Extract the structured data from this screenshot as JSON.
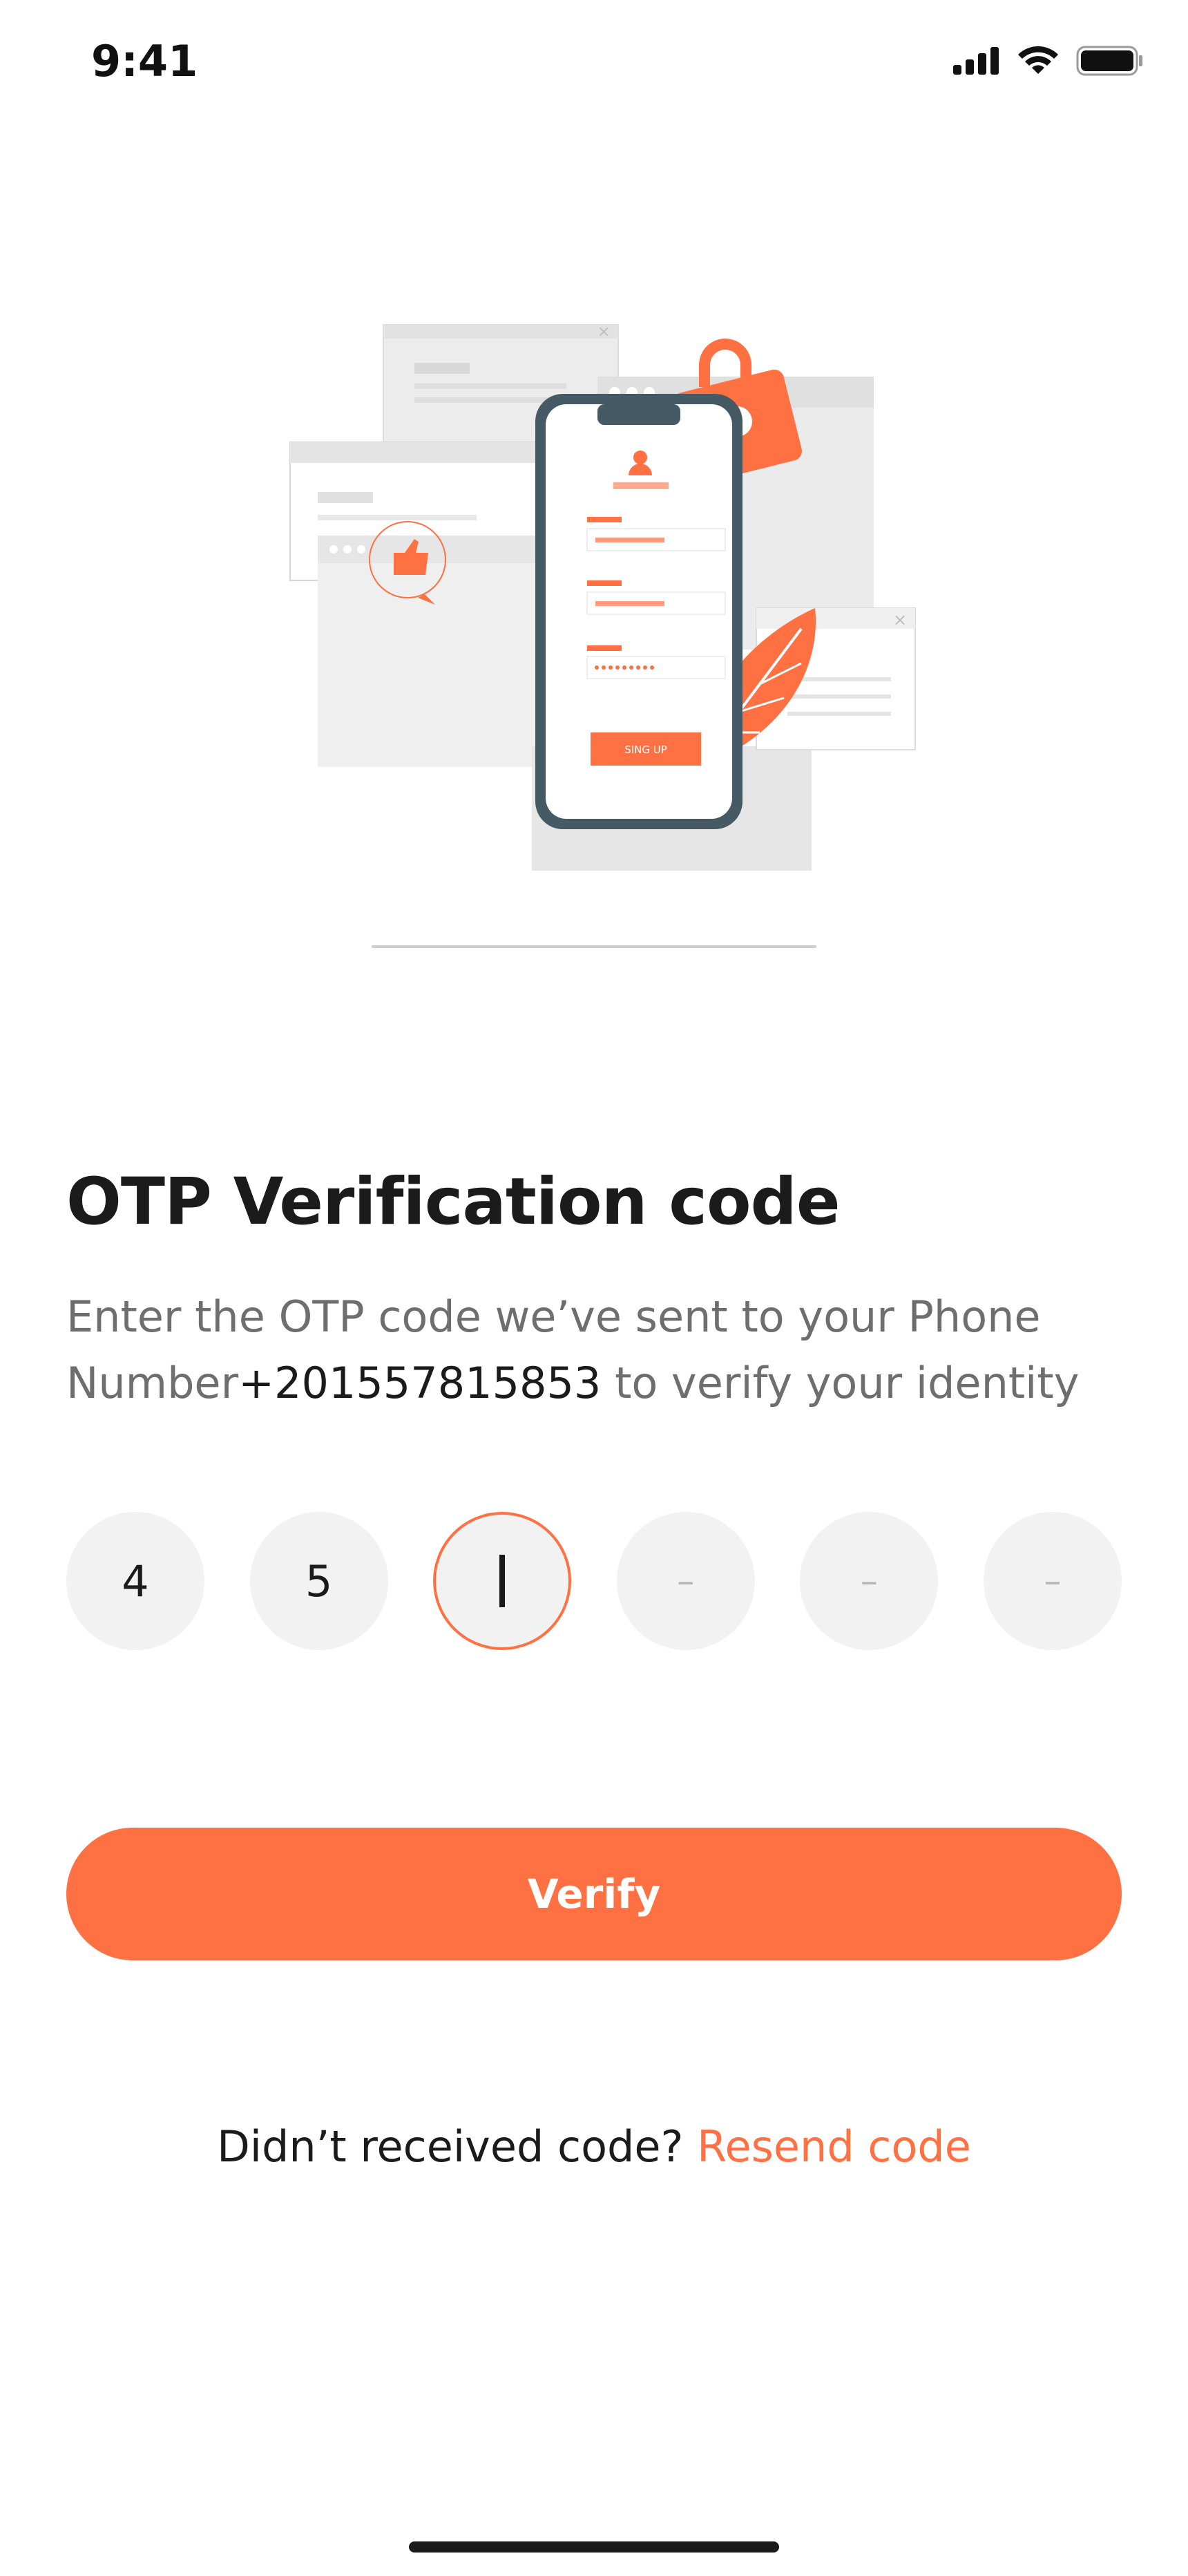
{
  "status_bar": {
    "time": "9:41",
    "icons": [
      "cellular-signal-icon",
      "wifi-icon",
      "battery-icon"
    ]
  },
  "illustration": {
    "button_label": "SING UP",
    "accent_color": "#ff7043"
  },
  "otp": {
    "title": "OTP Verification code",
    "instruction_prefix": "Enter the OTP code we’ve sent to your Phone Number",
    "phone_number": "+201557815853",
    "instruction_suffix": " to verify your identity",
    "digits": [
      {
        "value": "4",
        "state": "filled"
      },
      {
        "value": "5",
        "state": "filled"
      },
      {
        "value": "",
        "state": "active"
      },
      {
        "value": "–",
        "state": "empty"
      },
      {
        "value": "–",
        "state": "empty"
      },
      {
        "value": "–",
        "state": "empty"
      }
    ]
  },
  "actions": {
    "verify_label": "Verify",
    "resend_prompt": "Didn’t received code? ",
    "resend_label": "Resend code"
  },
  "colors": {
    "accent": "#ff7043",
    "input_bg": "#f2f2f2",
    "text_primary": "#1b1b1b",
    "text_secondary": "#6e6e6e"
  }
}
